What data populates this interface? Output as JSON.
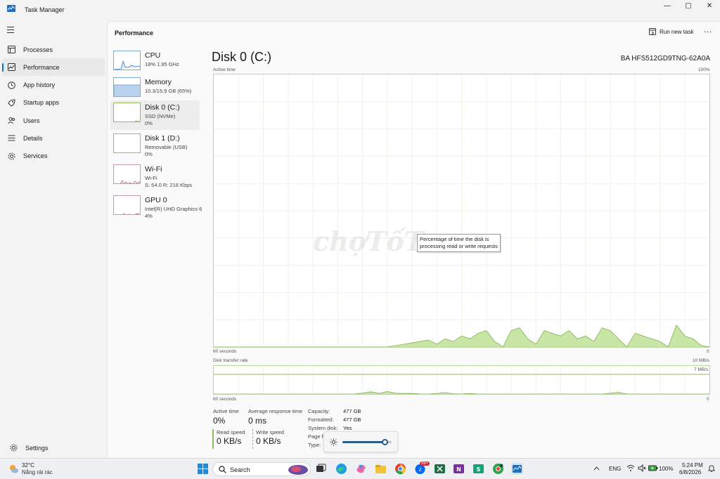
{
  "window": {
    "title": "Task Manager",
    "controls": {
      "minimize": "—",
      "maximize": "▢",
      "close": "✕"
    }
  },
  "sidebar": {
    "items": [
      {
        "label": "Processes",
        "icon": "processes-icon"
      },
      {
        "label": "Performance",
        "icon": "performance-icon"
      },
      {
        "label": "App history",
        "icon": "app-history-icon"
      },
      {
        "label": "Startup apps",
        "icon": "startup-apps-icon"
      },
      {
        "label": "Users",
        "icon": "users-icon"
      },
      {
        "label": "Details",
        "icon": "details-icon"
      },
      {
        "label": "Services",
        "icon": "services-icon"
      }
    ],
    "settings_label": "Settings"
  },
  "header": {
    "title": "Performance",
    "run_new_task": "Run new task",
    "more": "..."
  },
  "devices": [
    {
      "name": "CPU",
      "sub1": "18%  1.95 GHz",
      "sub2": ""
    },
    {
      "name": "Memory",
      "sub1": "10.3/15.9 GB (65%)",
      "sub2": ""
    },
    {
      "name": "Disk 0 (C:)",
      "sub1": "SSD (NVMe)",
      "sub2": "0%"
    },
    {
      "name": "Disk 1 (D:)",
      "sub1": "Removable (USB)",
      "sub2": "0%"
    },
    {
      "name": "Wi-Fi",
      "sub1": "Wi-Fi",
      "sub2": "S: 64.0  R: 216 Kbps"
    },
    {
      "name": "GPU 0",
      "sub1": "Intel(R) UHD Graphics 6",
      "sub2": "4%"
    }
  ],
  "detail": {
    "title": "Disk 0 (C:)",
    "model": "BA HFS512GD9TNG-62A0A",
    "active_time_label": "Active time",
    "active_time_max": "100%",
    "seconds_label_1": "60 seconds",
    "zero_label_1": "0",
    "transfer_label": "Disk transfer rate",
    "transfer_max": "10 MB/s",
    "transfer_line_label": "7 MB/s",
    "seconds_label_2": "60 seconds",
    "zero_label_2": "0",
    "tooltip_line1": "Percentage of time the disk is",
    "tooltip_line2": "processing read or write requests",
    "watermark": "chợTốT"
  },
  "stats": {
    "active_time_label": "Active time",
    "active_time_value": "0%",
    "response_label": "Average response time",
    "response_value": "0 ms",
    "read_label": "Read speed",
    "read_value": "0 KB/s",
    "write_label": "Write speed",
    "write_value": "0 KB/s"
  },
  "properties": {
    "capacity_label": "Capacity:",
    "capacity_value": "477 GB",
    "formatted_label": "Formatted:",
    "formatted_value": "477 GB",
    "system_disk_label": "System disk:",
    "system_disk_value": "Yes",
    "page_file_label": "Page f",
    "type_label": "Type:"
  },
  "brightness": {
    "level": 0.85
  },
  "chart_data": [
    {
      "type": "area",
      "title": "Active time",
      "ylim": [
        0,
        100
      ],
      "x": [
        0,
        1,
        2,
        3,
        4,
        5,
        6,
        7,
        8,
        9,
        10,
        11,
        12,
        13,
        14,
        15,
        16,
        17,
        18,
        19,
        20,
        21,
        22,
        23,
        24,
        25,
        26,
        27,
        28,
        29,
        30,
        31,
        32,
        33,
        34,
        35,
        36,
        37,
        38,
        39,
        40,
        41,
        42,
        43,
        44,
        45,
        46,
        47,
        48,
        49,
        50,
        51,
        52,
        53,
        54,
        55,
        56,
        57,
        58,
        59,
        60
      ],
      "values": [
        0,
        0,
        0,
        0,
        0,
        0,
        0,
        0,
        0,
        0,
        0,
        0,
        0,
        0,
        0,
        0,
        0,
        0,
        0,
        0,
        0,
        0,
        0.5,
        1,
        1.5,
        2,
        2.5,
        1,
        3,
        2,
        4,
        3,
        5,
        6,
        2,
        0,
        6,
        7,
        3,
        1,
        6,
        5,
        4,
        6,
        3,
        4,
        2,
        7,
        6,
        3,
        0,
        5,
        4,
        3,
        2,
        0,
        8,
        4,
        3,
        0.5,
        0
      ]
    },
    {
      "type": "area",
      "title": "Disk transfer rate",
      "ylim": [
        0,
        10
      ],
      "x": [
        0,
        1,
        2,
        3,
        4,
        5,
        6,
        7,
        8,
        9,
        10,
        11,
        12,
        13,
        14,
        15,
        16,
        17,
        18,
        19,
        20,
        21,
        22,
        23,
        24,
        25,
        26,
        27,
        28,
        29,
        30,
        31,
        32,
        33,
        34,
        35,
        36,
        37,
        38,
        39,
        40,
        41,
        42,
        43,
        44,
        45,
        46,
        47,
        48,
        49,
        50,
        51,
        52,
        53,
        54,
        55,
        56,
        57,
        58,
        59,
        60
      ],
      "values": [
        0,
        0,
        0,
        0,
        0,
        0,
        0,
        0,
        0,
        0,
        0,
        0,
        0,
        0,
        0,
        0,
        0,
        0,
        0.3,
        0.8,
        0.2,
        0.9,
        0.3,
        0.2,
        0.2,
        0,
        0,
        0.2,
        0.5,
        0.1,
        0,
        0.2,
        0,
        0,
        0,
        0,
        0,
        0,
        0,
        0,
        0,
        0,
        0,
        0,
        0,
        0,
        0,
        0,
        0.3,
        0.6,
        0,
        0,
        0,
        0,
        0,
        0,
        0,
        0,
        0,
        0,
        0
      ]
    }
  ],
  "taskbar": {
    "weather_temp": "32°C",
    "weather_desc": "Nắng rải rác",
    "search_label": "Search",
    "language": "ENG",
    "battery": "100%",
    "time": "5:24 PM",
    "date": "6/8/2026",
    "badge_count": "99+"
  }
}
